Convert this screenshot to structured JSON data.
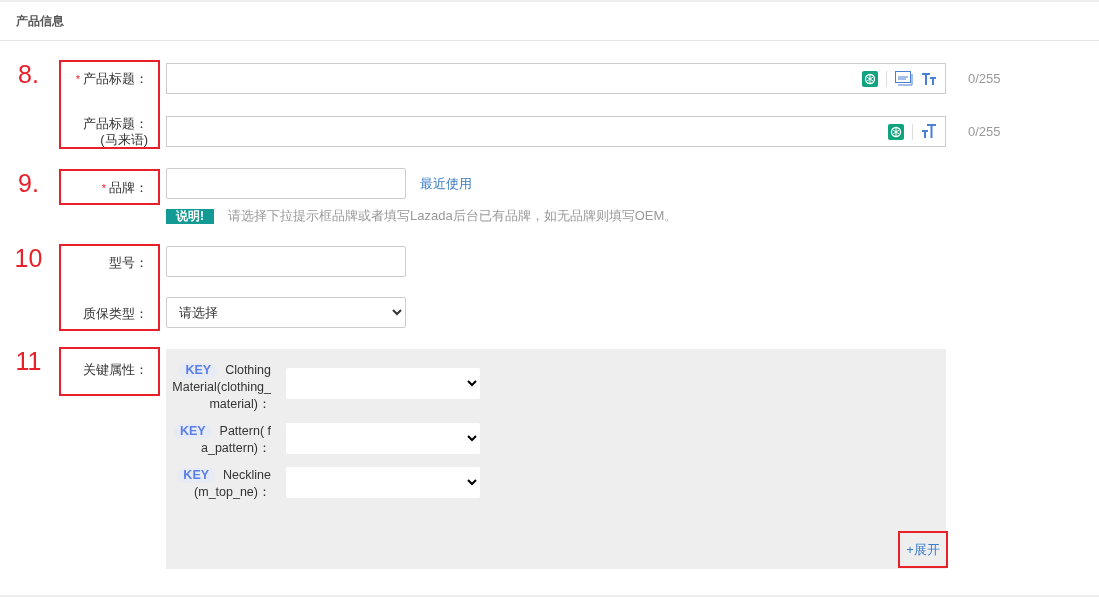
{
  "section_title": "产品信息",
  "groups": [
    {
      "number": "8.",
      "fields": [
        {
          "kind": "title",
          "marker": "*",
          "label": "产品标题：",
          "counter": "0/255"
        },
        {
          "kind": "title_local",
          "label": "产品标题：",
          "sublabel": "(马来语)",
          "counter": "0/255"
        }
      ]
    },
    {
      "number": "9.",
      "fields": [
        {
          "kind": "brand",
          "marker": "*",
          "label": "品牌：",
          "link": "最近使用",
          "note_badge": "说明!",
          "note": "请选择下拉提示框品牌或者填写Lazada后台已有品牌，如无品牌则填写OEM。"
        }
      ]
    },
    {
      "number": "10",
      "fields": [
        {
          "kind": "text",
          "label": "型号："
        },
        {
          "kind": "select",
          "label": "质保类型：",
          "value": "请选择"
        }
      ]
    },
    {
      "number": "11",
      "fields": [
        {
          "kind": "attributes",
          "label": "关键属性：",
          "expand": "+展开",
          "attributes": [
            {
              "badge": "KEY",
              "label": "Clothing Material(clothing_material)："
            },
            {
              "badge": "KEY",
              "label": "Pattern( fa_pattern)："
            },
            {
              "badge": "KEY",
              "label": "Neckline(m_top_ne)："
            }
          ]
        }
      ]
    }
  ]
}
